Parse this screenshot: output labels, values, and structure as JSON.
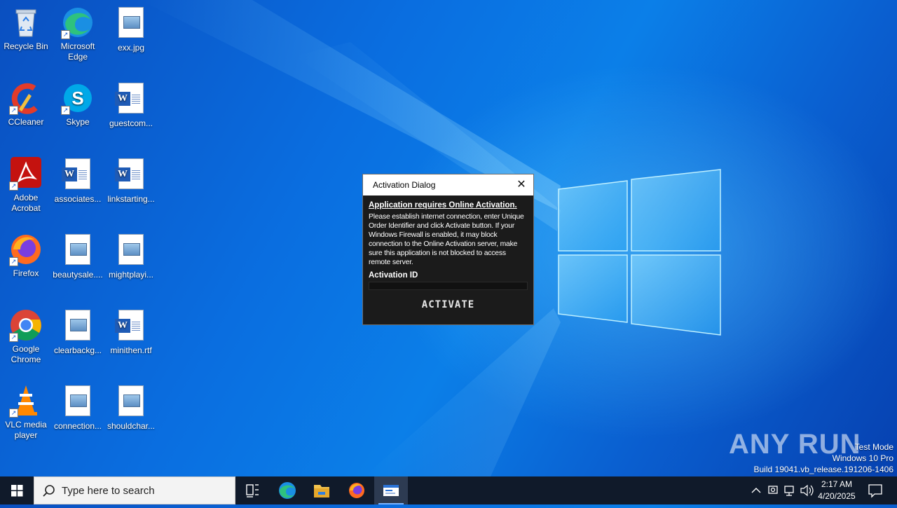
{
  "desktop": {
    "icons": [
      {
        "label": "Recycle Bin"
      },
      {
        "label": "Microsoft Edge"
      },
      {
        "label": "exx.jpg"
      },
      {
        "label": "CCleaner"
      },
      {
        "label": "Skype"
      },
      {
        "label": "guestcom..."
      },
      {
        "label": "Adobe Acrobat"
      },
      {
        "label": "associates..."
      },
      {
        "label": "linkstarting..."
      },
      {
        "label": "Firefox"
      },
      {
        "label": "beautysale...."
      },
      {
        "label": "mightplayi..."
      },
      {
        "label": "Google Chrome"
      },
      {
        "label": "clearbackg..."
      },
      {
        "label": "minithen.rtf"
      },
      {
        "label": "VLC media player"
      },
      {
        "label": "connection..."
      },
      {
        "label": "shouldchar..."
      }
    ]
  },
  "dialog": {
    "title": "Activation Dialog",
    "heading": "Application requires Online Activation.",
    "body": "Please establish internet connection, enter Unique Order Identifier and click Activate button. If your Windows Firewall is enabled, it may block connection to the Online Activation server, make sure this application is not blocked to access remote server.",
    "field_label": "Activation ID",
    "field_value": "",
    "button_label": "ACTIVATE"
  },
  "watermark": {
    "brand": "ANY RUN",
    "line1": "Test Mode",
    "line2": "Windows 10 Pro",
    "line3": "Build 19041.vb_release.191206-1406"
  },
  "taskbar": {
    "search_placeholder": "Type here to search",
    "time": "2:17 AM",
    "date": "4/20/2025"
  },
  "colors": {
    "desktop_blue": "#0a6ee0",
    "taskbar": "#101a2a",
    "dialog_bg": "#1b1b1b"
  }
}
